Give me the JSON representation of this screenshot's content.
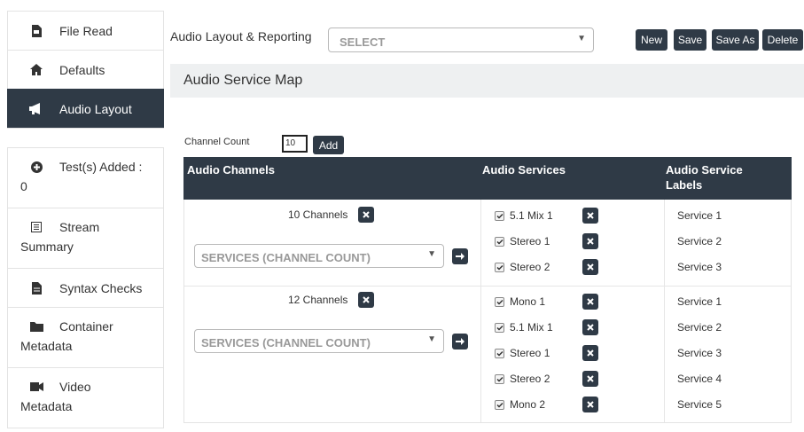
{
  "sidebar": {
    "items": [
      {
        "label": "File Read",
        "icon": "file-icon"
      },
      {
        "label": "Defaults",
        "icon": "home-icon"
      },
      {
        "label": "Audio Layout",
        "icon": "megaphone-icon",
        "active": true
      },
      {
        "label": "Test(s) Added :",
        "sub": "0",
        "icon": "plus-circle-icon"
      },
      {
        "label": "Stream",
        "sub": "Summary",
        "icon": "list-icon"
      },
      {
        "label": "Syntax Checks",
        "icon": "document-icon"
      },
      {
        "label": "Container",
        "sub": "Metadata",
        "icon": "folder-icon"
      },
      {
        "label": "Video",
        "sub": "Metadata",
        "icon": "video-camera-icon"
      }
    ]
  },
  "toolbar": {
    "label": "Audio Layout & Reporting",
    "select_value": "SELECT",
    "new_label": "New",
    "save_label": "Save",
    "save_as_label": "Save As",
    "delete_label": "Delete"
  },
  "panel": {
    "title": "Audio Service Map",
    "channel_count_label": "Channel Count",
    "channel_count_value": "10",
    "add_label": "Add"
  },
  "table": {
    "headers": [
      "Audio Channels",
      "Audio Services",
      "Audio Service Labels"
    ],
    "groups": [
      {
        "channels_label": "10 Channels",
        "select_value": "SERVICES (CHANNEL COUNT)",
        "services": [
          {
            "name": "5.1 Mix 1",
            "label": "Service 1"
          },
          {
            "name": "Stereo 1",
            "label": "Service 2"
          },
          {
            "name": "Stereo 2",
            "label": "Service 3"
          }
        ]
      },
      {
        "channels_label": "12 Channels",
        "select_value": "SERVICES (CHANNEL COUNT)",
        "services": [
          {
            "name": "Mono 1",
            "label": "Service 1"
          },
          {
            "name": "5.1 Mix 1",
            "label": "Service 2"
          },
          {
            "name": "Stereo 1",
            "label": "Service 3"
          },
          {
            "name": "Stereo 2",
            "label": "Service 4"
          },
          {
            "name": "Mono 2",
            "label": "Service 5"
          }
        ]
      }
    ]
  },
  "colors": {
    "dark": "#2f3a46",
    "panel_bg": "#eef0f1",
    "border": "#e3e3e3"
  }
}
